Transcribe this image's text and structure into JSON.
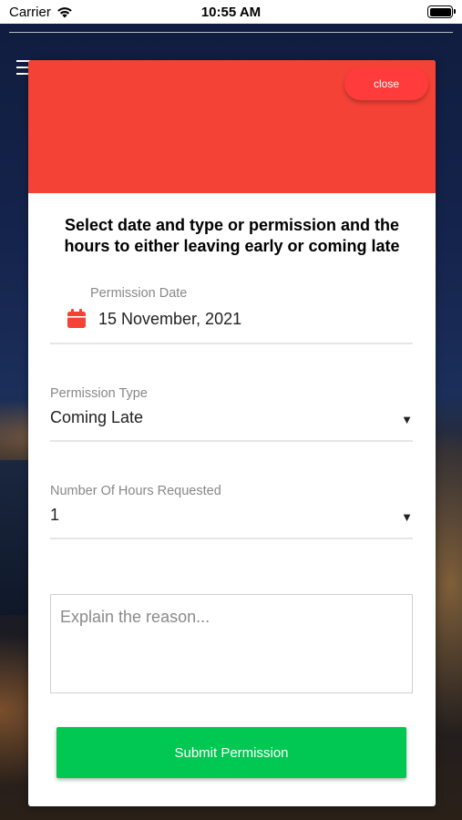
{
  "status_bar": {
    "carrier": "Carrier",
    "time": "10:55 AM",
    "wifi_icon": "wifi-icon",
    "battery_icon": "battery-icon"
  },
  "nav": {
    "menu_icon": "hamburger-menu-icon"
  },
  "modal": {
    "header_color": "#f44336",
    "close_label": "close",
    "instructions": "Select date and type or permission and the hours to either leaving early or coming late",
    "permission_date": {
      "label": "Permission Date",
      "value": "15 November, 2021",
      "icon": "calendar-icon",
      "icon_color": "#f44336"
    },
    "permission_type": {
      "label": "Permission Type",
      "value": "Coming Late",
      "dropdown_icon": "▼"
    },
    "hours_requested": {
      "label": "Number Of Hours Requested",
      "value": "1",
      "dropdown_icon": "▼"
    },
    "reason": {
      "placeholder": "Explain the reason...",
      "value": ""
    },
    "submit_label": "Submit Permission",
    "submit_color": "#00c853"
  }
}
